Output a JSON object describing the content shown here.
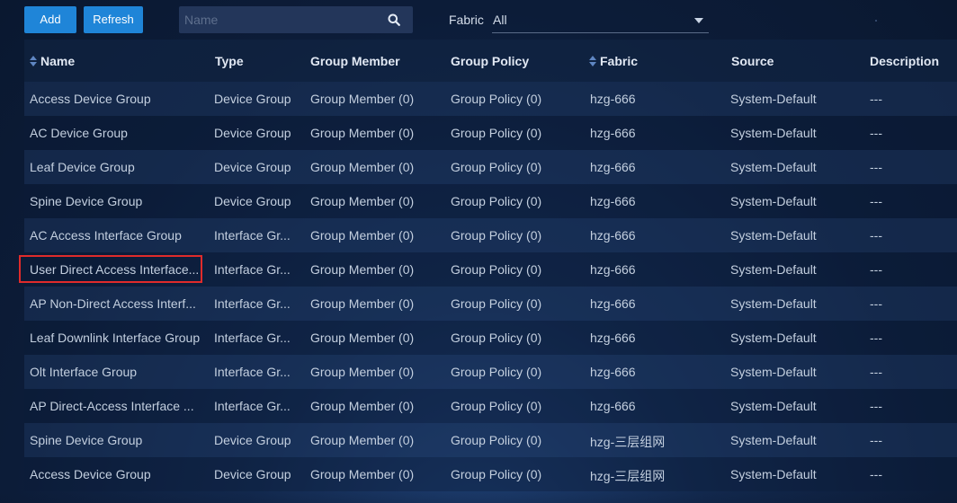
{
  "toolbar": {
    "add_label": "Add",
    "refresh_label": "Refresh",
    "search_placeholder": "Name",
    "search_value": "",
    "fabric_label": "Fabric",
    "fabric_value": "All"
  },
  "table": {
    "columns": [
      "Name",
      "Type",
      "Group Member",
      "Group Policy",
      "Fabric",
      "Source",
      "Description"
    ],
    "rows": [
      {
        "name": "Access Device Group",
        "type": "Device Group",
        "member": "Group Member (0)",
        "policy": "Group Policy (0)",
        "fabric": "hzg-666",
        "source": "System-Default",
        "desc": "---"
      },
      {
        "name": "AC Device Group",
        "type": "Device Group",
        "member": "Group Member (0)",
        "policy": "Group Policy (0)",
        "fabric": "hzg-666",
        "source": "System-Default",
        "desc": "---"
      },
      {
        "name": "Leaf Device Group",
        "type": "Device Group",
        "member": "Group Member (0)",
        "policy": "Group Policy (0)",
        "fabric": "hzg-666",
        "source": "System-Default",
        "desc": "---"
      },
      {
        "name": "Spine Device Group",
        "type": "Device Group",
        "member": "Group Member (0)",
        "policy": "Group Policy (0)",
        "fabric": "hzg-666",
        "source": "System-Default",
        "desc": "---"
      },
      {
        "name": "AC Access Interface Group",
        "type": "Interface Gr...",
        "member": "Group Member (0)",
        "policy": "Group Policy (0)",
        "fabric": "hzg-666",
        "source": "System-Default",
        "desc": "---"
      },
      {
        "name": "User Direct Access Interface...",
        "type": "Interface Gr...",
        "member": "Group Member (0)",
        "policy": "Group Policy (0)",
        "fabric": "hzg-666",
        "source": "System-Default",
        "desc": "---"
      },
      {
        "name": "AP Non-Direct Access Interf...",
        "type": "Interface Gr...",
        "member": "Group Member (0)",
        "policy": "Group Policy (0)",
        "fabric": "hzg-666",
        "source": "System-Default",
        "desc": "---"
      },
      {
        "name": "Leaf Downlink Interface Group",
        "type": "Interface Gr...",
        "member": "Group Member (0)",
        "policy": "Group Policy (0)",
        "fabric": "hzg-666",
        "source": "System-Default",
        "desc": "---"
      },
      {
        "name": "Olt Interface Group",
        "type": "Interface Gr...",
        "member": "Group Member (0)",
        "policy": "Group Policy (0)",
        "fabric": "hzg-666",
        "source": "System-Default",
        "desc": "---"
      },
      {
        "name": "AP Direct-Access Interface ...",
        "type": "Interface Gr...",
        "member": "Group Member (0)",
        "policy": "Group Policy (0)",
        "fabric": "hzg-666",
        "source": "System-Default",
        "desc": "---"
      },
      {
        "name": "Spine Device Group",
        "type": "Device Group",
        "member": "Group Member (0)",
        "policy": "Group Policy (0)",
        "fabric": "hzg-三层组网",
        "source": "System-Default",
        "desc": "---"
      },
      {
        "name": "Access Device Group",
        "type": "Device Group",
        "member": "Group Member (0)",
        "policy": "Group Policy (0)",
        "fabric": "hzg-三层组网",
        "source": "System-Default",
        "desc": "---"
      }
    ],
    "selected_row": 5
  },
  "icons": {
    "search": "search-icon",
    "sort": "sort-icon",
    "dropdown": "chevron-down-icon"
  },
  "colors": {
    "primary_button": "#1f85d8",
    "highlight_border": "#e02b2b"
  }
}
